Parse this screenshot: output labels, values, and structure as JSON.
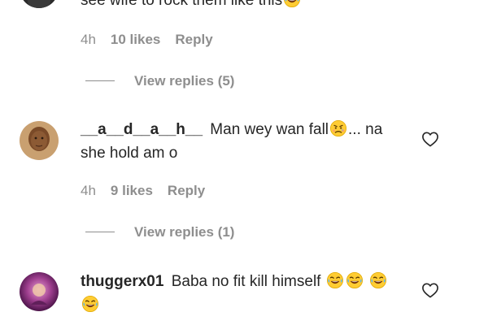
{
  "comments": [
    {
      "username": "",
      "text": "see wife to rock them like this",
      "emoji": [
        "laughing-tears-emoji"
      ],
      "time": "4h",
      "likes": "10 likes",
      "reply_label": "Reply",
      "view_replies": "View replies (5)"
    },
    {
      "username": "__a__d__a__h__",
      "text": "Man wey wan fall",
      "text_after": "... na she hold am o",
      "emoji": [
        "worried-face-emoji"
      ],
      "time": "4h",
      "likes": "9 likes",
      "reply_label": "Reply",
      "view_replies": "View replies (1)"
    },
    {
      "username": "thuggerx01",
      "text": "Baba no fit kill himself",
      "emoji": [
        "laughing-tears-emoji",
        "laughing-tears-emoji",
        "laughing-tears-emoji",
        "laughing-tears-emoji"
      ]
    }
  ],
  "colors": {
    "text": "#262626",
    "muted": "#8e8e8e",
    "background": "#ffffff"
  },
  "icons": {
    "like": "heart-outline-icon"
  }
}
